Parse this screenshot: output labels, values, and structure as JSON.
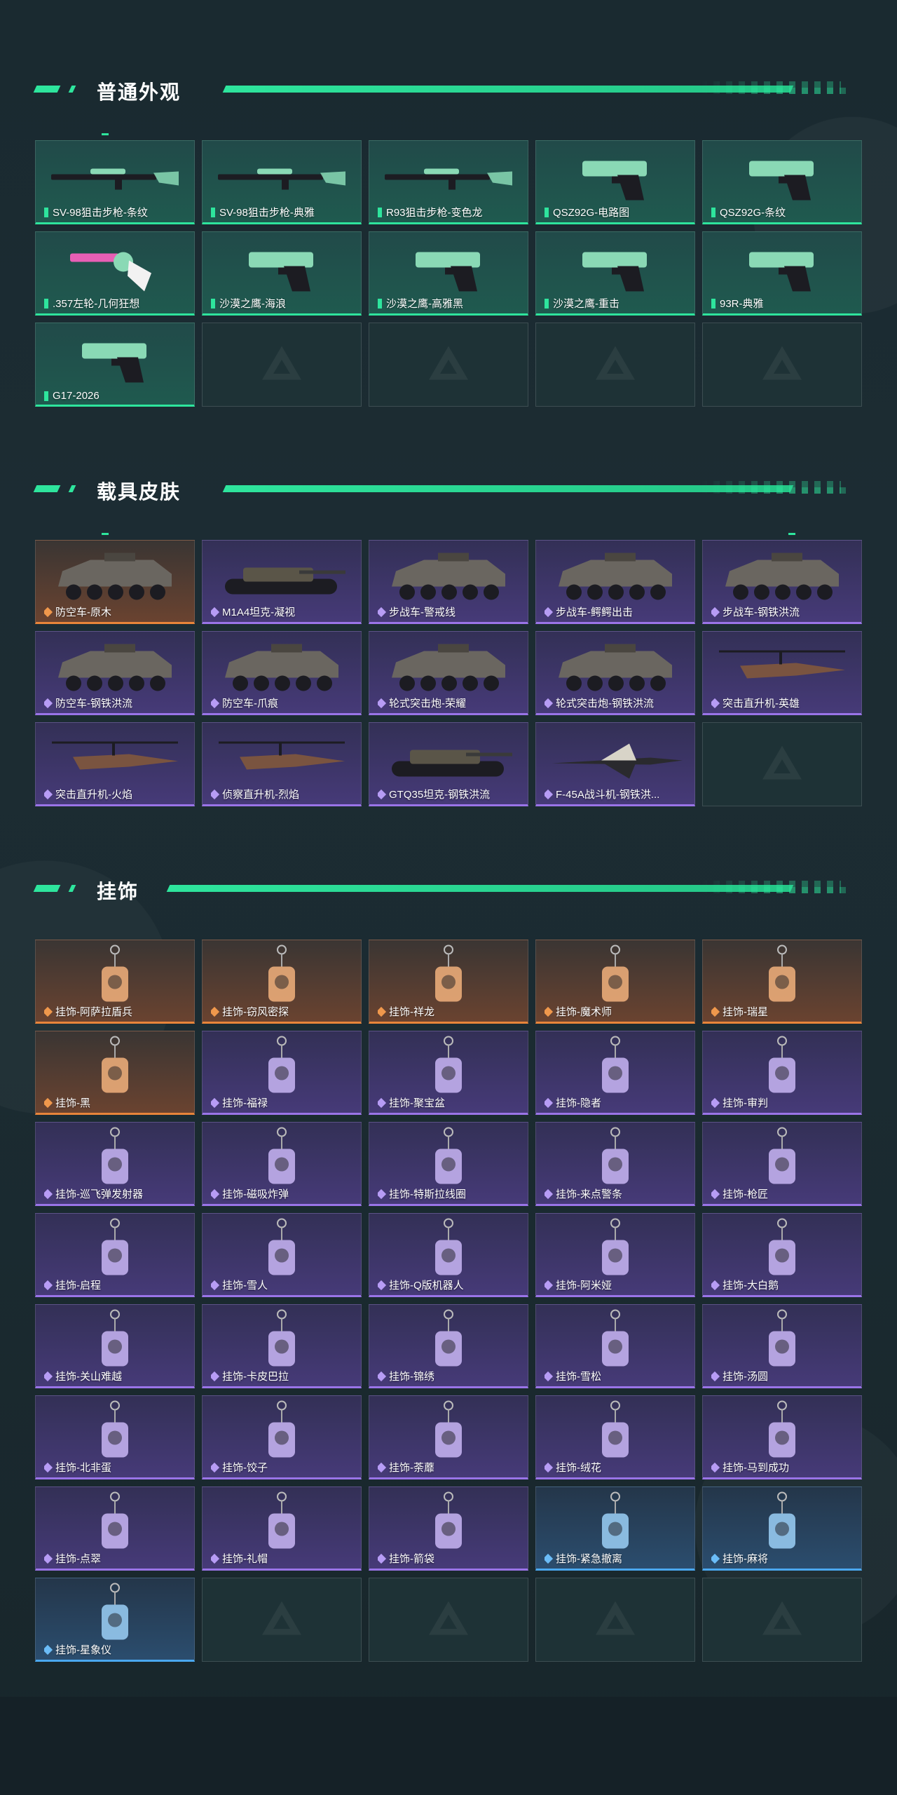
{
  "colors": {
    "accent": "#2ee59d",
    "green_tier": "#2ee59d",
    "purple_tier": "#9a74e8",
    "orange_tier": "#e8843a",
    "blue_tier": "#4aa8f0"
  },
  "sections": [
    {
      "title": "普通外观",
      "items": [
        {
          "label": "SV-98狙击步枪-条纹",
          "tier": "green",
          "icon": "sniper-rifle-icon"
        },
        {
          "label": "SV-98狙击步枪-典雅",
          "tier": "green",
          "icon": "sniper-rifle-icon"
        },
        {
          "label": "R93狙击步枪-变色龙",
          "tier": "green",
          "icon": "sniper-rifle-icon"
        },
        {
          "label": "QSZ92G-电路图",
          "tier": "green",
          "icon": "pistol-icon"
        },
        {
          "label": "QSZ92G-条纹",
          "tier": "green",
          "icon": "pistol-icon"
        },
        {
          "label": ".357左轮-几何狂想",
          "tier": "green",
          "icon": "revolver-icon"
        },
        {
          "label": "沙漠之鹰-海浪",
          "tier": "green",
          "icon": "pistol-icon"
        },
        {
          "label": "沙漠之鹰-高雅黑",
          "tier": "green",
          "icon": "pistol-icon"
        },
        {
          "label": "沙漠之鹰-重击",
          "tier": "green",
          "icon": "pistol-icon"
        },
        {
          "label": "93R-典雅",
          "tier": "green",
          "icon": "pistol-icon"
        },
        {
          "label": "G17-2026",
          "tier": "green",
          "icon": "pistol-icon"
        }
      ]
    },
    {
      "title": "载具皮肤",
      "items": [
        {
          "label": "防空车-原木",
          "tier": "orange",
          "icon": "armored-vehicle-icon"
        },
        {
          "label": "M1A4坦克-凝视",
          "tier": "purple",
          "icon": "tank-icon"
        },
        {
          "label": "步战车-警戒线",
          "tier": "purple",
          "icon": "armored-vehicle-icon"
        },
        {
          "label": "步战车-鳄鳄出击",
          "tier": "purple",
          "icon": "armored-vehicle-icon"
        },
        {
          "label": "步战车-钢铁洪流",
          "tier": "purple",
          "icon": "armored-vehicle-icon"
        },
        {
          "label": "防空车-钢铁洪流",
          "tier": "purple",
          "icon": "armored-vehicle-icon"
        },
        {
          "label": "防空车-爪痕",
          "tier": "purple",
          "icon": "armored-vehicle-icon"
        },
        {
          "label": "轮式突击炮-荣耀",
          "tier": "purple",
          "icon": "armored-vehicle-icon"
        },
        {
          "label": "轮式突击炮-钢铁洪流",
          "tier": "purple",
          "icon": "armored-vehicle-icon"
        },
        {
          "label": "突击直升机-英雄",
          "tier": "purple",
          "icon": "helicopter-icon"
        },
        {
          "label": "突击直升机-火焰",
          "tier": "purple",
          "icon": "helicopter-icon"
        },
        {
          "label": "侦察直升机-烈焰",
          "tier": "purple",
          "icon": "helicopter-icon"
        },
        {
          "label": "GTQ35坦克-钢铁洪流",
          "tier": "purple",
          "icon": "tank-icon"
        },
        {
          "label": "F-45A战斗机-钢铁洪...",
          "tier": "purple",
          "icon": "jet-icon"
        }
      ]
    },
    {
      "title": "挂饰",
      "items": [
        {
          "label": "挂饰-阿萨拉盾兵",
          "tier": "orange",
          "icon": "charm-icon"
        },
        {
          "label": "挂饰-窃风密探",
          "tier": "orange",
          "icon": "charm-icon"
        },
        {
          "label": "挂饰-祥龙",
          "tier": "orange",
          "icon": "charm-icon"
        },
        {
          "label": "挂饰-魔术师",
          "tier": "orange",
          "icon": "charm-icon"
        },
        {
          "label": "挂饰-瑞星",
          "tier": "orange",
          "icon": "charm-icon"
        },
        {
          "label": "挂饰-黑",
          "tier": "orange",
          "icon": "charm-icon"
        },
        {
          "label": "挂饰-福禄",
          "tier": "purple",
          "icon": "charm-icon"
        },
        {
          "label": "挂饰-聚宝盆",
          "tier": "purple",
          "icon": "charm-icon"
        },
        {
          "label": "挂饰-隐者",
          "tier": "purple",
          "icon": "charm-icon"
        },
        {
          "label": "挂饰-审判",
          "tier": "purple",
          "icon": "charm-icon"
        },
        {
          "label": "挂饰-巡飞弹发射器",
          "tier": "purple",
          "icon": "charm-icon"
        },
        {
          "label": "挂饰-磁吸炸弹",
          "tier": "purple",
          "icon": "charm-icon"
        },
        {
          "label": "挂饰-特斯拉线圈",
          "tier": "purple",
          "icon": "charm-icon"
        },
        {
          "label": "挂饰-来点警条",
          "tier": "purple",
          "icon": "charm-icon"
        },
        {
          "label": "挂饰-枪匠",
          "tier": "purple",
          "icon": "charm-icon"
        },
        {
          "label": "挂饰-启程",
          "tier": "purple",
          "icon": "charm-icon"
        },
        {
          "label": "挂饰-雪人",
          "tier": "purple",
          "icon": "charm-icon"
        },
        {
          "label": "挂饰-Q版机器人",
          "tier": "purple",
          "icon": "charm-icon"
        },
        {
          "label": "挂饰-阿米娅",
          "tier": "purple",
          "icon": "charm-icon"
        },
        {
          "label": "挂饰-大白鹅",
          "tier": "purple",
          "icon": "charm-icon"
        },
        {
          "label": "挂饰-关山难越",
          "tier": "purple",
          "icon": "charm-icon"
        },
        {
          "label": "挂饰-卡皮巴拉",
          "tier": "purple",
          "icon": "charm-icon"
        },
        {
          "label": "挂饰-锦绣",
          "tier": "purple",
          "icon": "charm-icon"
        },
        {
          "label": "挂饰-雪松",
          "tier": "purple",
          "icon": "charm-icon"
        },
        {
          "label": "挂饰-汤圆",
          "tier": "purple",
          "icon": "charm-icon"
        },
        {
          "label": "挂饰-北非蛋",
          "tier": "purple",
          "icon": "charm-icon"
        },
        {
          "label": "挂饰-饺子",
          "tier": "purple",
          "icon": "charm-icon"
        },
        {
          "label": "挂饰-荼蘼",
          "tier": "purple",
          "icon": "charm-icon"
        },
        {
          "label": "挂饰-绒花",
          "tier": "purple",
          "icon": "charm-icon"
        },
        {
          "label": "挂饰-马到成功",
          "tier": "purple",
          "icon": "charm-icon"
        },
        {
          "label": "挂饰-点翠",
          "tier": "purple",
          "icon": "charm-icon"
        },
        {
          "label": "挂饰-礼帽",
          "tier": "purple",
          "icon": "charm-icon"
        },
        {
          "label": "挂饰-箭袋",
          "tier": "purple",
          "icon": "charm-icon"
        },
        {
          "label": "挂饰-紧急撤离",
          "tier": "blue",
          "icon": "charm-icon"
        },
        {
          "label": "挂饰-麻将",
          "tier": "blue",
          "icon": "charm-icon"
        },
        {
          "label": "挂饰-星象仪",
          "tier": "blue",
          "icon": "charm-icon"
        }
      ]
    }
  ]
}
